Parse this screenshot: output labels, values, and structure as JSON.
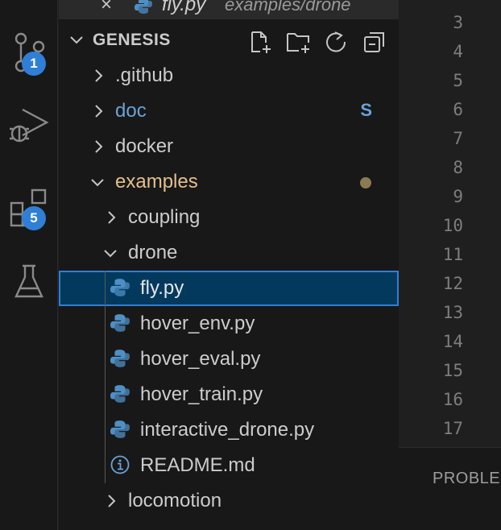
{
  "activity_bar": {
    "items": [
      {
        "name": "source-control",
        "badge": "1"
      },
      {
        "name": "run-and-debug",
        "badge": ""
      },
      {
        "name": "extensions",
        "badge": "5"
      },
      {
        "name": "testing",
        "badge": ""
      }
    ],
    "badge_color": "#2f7fd6"
  },
  "open_editor": {
    "close_glyph": "×",
    "file_name": "fly.py",
    "file_path": "examples/drone"
  },
  "explorer": {
    "section_title": "GENESIS",
    "actions": [
      "new-file",
      "new-folder",
      "refresh",
      "collapse-all"
    ],
    "tree": [
      {
        "label": ".github",
        "type": "folder",
        "expanded": false,
        "depth": 0
      },
      {
        "label": "doc",
        "type": "folder",
        "expanded": false,
        "depth": 0,
        "decoration": "S"
      },
      {
        "label": "docker",
        "type": "folder",
        "expanded": false,
        "depth": 0
      },
      {
        "label": "examples",
        "type": "folder",
        "expanded": true,
        "depth": 0,
        "decoration": "dot"
      },
      {
        "label": "coupling",
        "type": "folder",
        "expanded": false,
        "depth": 1
      },
      {
        "label": "drone",
        "type": "folder",
        "expanded": true,
        "depth": 1
      },
      {
        "label": "fly.py",
        "type": "python",
        "depth": 2,
        "selected": true
      },
      {
        "label": "hover_env.py",
        "type": "python",
        "depth": 2
      },
      {
        "label": "hover_eval.py",
        "type": "python",
        "depth": 2
      },
      {
        "label": "hover_train.py",
        "type": "python",
        "depth": 2
      },
      {
        "label": "interactive_drone.py",
        "type": "python",
        "depth": 2
      },
      {
        "label": "README.md",
        "type": "info",
        "depth": 2
      },
      {
        "label": "locomotion",
        "type": "folder",
        "expanded": false,
        "depth": 1
      }
    ]
  },
  "editor": {
    "line_numbers": [
      "3",
      "4",
      "5",
      "6",
      "7",
      "8",
      "9",
      "10",
      "11",
      "12",
      "13",
      "14",
      "15",
      "16",
      "17"
    ]
  },
  "panel": {
    "tab_label": "PROBLEMS"
  },
  "colors": {
    "selection_bg": "#04395e",
    "selection_border": "#2f7fd6",
    "modified_blue": "#6aa2d8",
    "folder_modified": "#e2c08d",
    "python_icon": "#4f8fc6"
  }
}
